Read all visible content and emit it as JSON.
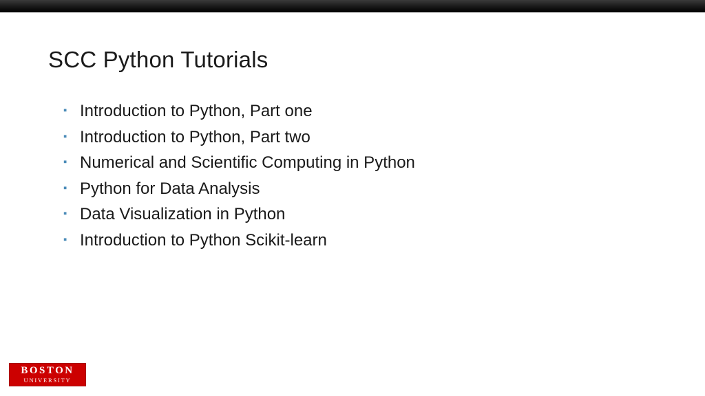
{
  "slide": {
    "title": "SCC Python Tutorials",
    "bullets": [
      "Introduction to Python, Part one",
      "Introduction to Python, Part two",
      "Numerical and Scientific Computing in Python",
      "Python for Data Analysis",
      "Data Visualization in Python",
      "Introduction to Python Scikit-learn"
    ]
  },
  "logo": {
    "main": "BOSTON",
    "sub": "UNIVERSITY"
  }
}
